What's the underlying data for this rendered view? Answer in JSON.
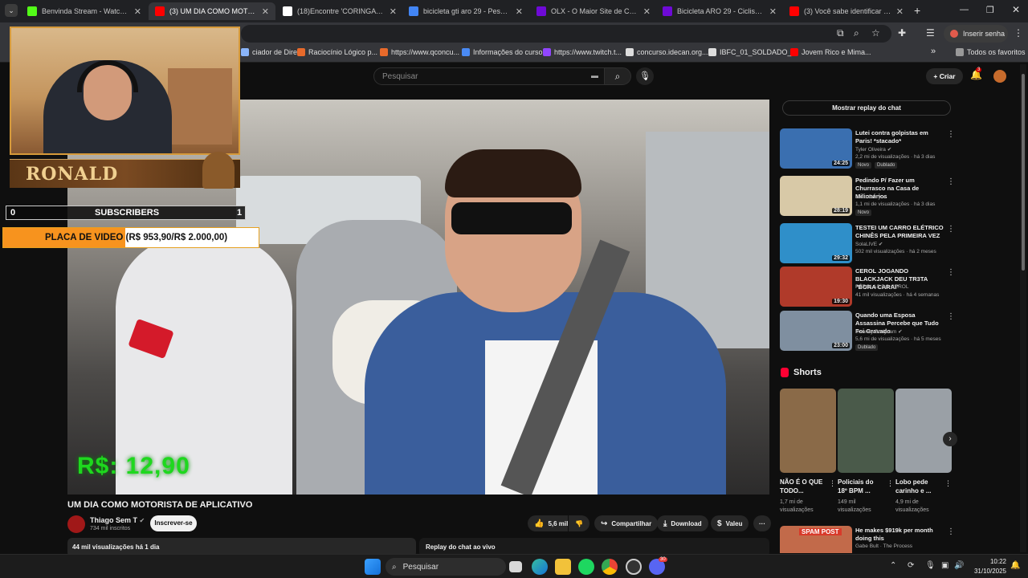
{
  "browser": {
    "tabs": [
      {
        "title": "Benvinda Stream - Watch Live o",
        "color": "#53fc18"
      },
      {
        "title": "(3) UM DIA COMO MOTOR",
        "color": "#ff0000",
        "active": true
      },
      {
        "title": "(18)Encontre 'CORINGA RESTA",
        "color": "#ffffff"
      },
      {
        "title": "bicicleta gti aro 29 - Pesquisa G",
        "color": "#4285f4"
      },
      {
        "title": "OLX - O Maior Site de Compra",
        "color": "#6e0ad6"
      },
      {
        "title": "Bicicleta ARO 29 - Ciclismo - S",
        "color": "#6e0ad6"
      },
      {
        "title": "(3) Você sabe identificar uma n",
        "color": "#ff0000"
      }
    ],
    "new_tab": "+",
    "incognito_label": "Inserir senha",
    "bookmarks": [
      {
        "label": "ciador de Dire...",
        "color": "#8ab4f8"
      },
      {
        "label": "Raciocínio Lógico p...",
        "color": "#e86a2b"
      },
      {
        "label": "https://www.qconcu...",
        "color": "#e86a2b"
      },
      {
        "label": "Informações do curso",
        "color": "#4a8af4"
      },
      {
        "label": "https://www.twitch.t...",
        "color": "#9146ff"
      },
      {
        "label": "concurso.idecan.org...",
        "color": "#dddddd"
      },
      {
        "label": "IBFC_01_SOLDADO_...",
        "color": "#dddddd"
      },
      {
        "label": "Jovem Rico e Mima...",
        "color": "#ff0000"
      }
    ],
    "bookmarks_overflow": "»",
    "all_bookmarks": "Todos os favoritos"
  },
  "youtube": {
    "search_placeholder": "Pesquisar",
    "create_label": "Criar",
    "notif_count": "3",
    "video": {
      "title": "UM DIA COMO MOTORISTA DE APLICATIVO",
      "price_overlay": "R$: 12,90",
      "channel_name": "Thiago Sem T",
      "channel_subs": "734 mil inscritos",
      "subscribe_label": "Inscrever-se",
      "likes": "5,6 mil",
      "share_label": "Compartilhar",
      "download_label": "Download",
      "thanks_label": "Valeu",
      "more_label": "···",
      "views_date": "44 mil visualizações  há 1 dia",
      "chat_replay_bottom": "Replay do chat ao vivo"
    },
    "chat_replay_button": "Mostrar replay do chat",
    "recommendations": [
      {
        "title": "Lutei contra golpistas em Paris! *stacado*",
        "channel": "Tyler Oliveira ✔",
        "meta": "2,2 mi de visualizações · há 3 dias",
        "duration": "24:25",
        "badge": "Novo",
        "badge2": "Dublado",
        "thumb": "#3a6fb0"
      },
      {
        "title": "Pedindo P/ Fazer um Churrasco na Casa de Milionários",
        "channel": "Joao Curry ✔",
        "meta": "1,1 mi de visualizações · há 3 dias",
        "duration": "28:19",
        "badge": "Novo",
        "badge2": "",
        "thumb": "#d8c9a7"
      },
      {
        "title": "TESTEI UM CARRO ELÉTRICO CHINÊS PELA PRIMEIRA VEZ",
        "channel": "SolaLIVE ✔",
        "meta": "502 mil visualizações · há 2 meses",
        "duration": "29:32",
        "badge": "",
        "badge2": "",
        "thumb": "#2f8fc9"
      },
      {
        "title": "CEROL JOGANDO BLACKJACK DEU TR3TA \"BORA CARAI\"",
        "channel": "PÉROLAS DO CEROL",
        "meta": "41 mil visualizações · há 4 semanas",
        "duration": "19:30",
        "badge": "",
        "badge2": "",
        "thumb": "#b03a2a"
      },
      {
        "title": "Quando uma Esposa Assassina Percebe que Tudo Foi Gravado",
        "channel": "Insanity Bodycam ✔",
        "meta": "5,6 mi de visualizações · há 5 meses",
        "duration": "23:00",
        "badge": "Dublado",
        "badge2": "",
        "thumb": "#7f8fa0"
      }
    ],
    "shorts_title": "Shorts",
    "shorts": [
      {
        "title": "NÃO É O QUE TODO...",
        "views": "1,7 mi de visualizações",
        "thumb": "#8a6a48"
      },
      {
        "title": "Policiais do 18º BPM ...",
        "views": "149 mil visualizações",
        "thumb": "#4a5a4a"
      },
      {
        "title": "Lobo pede carinho e ...",
        "views": "4,9 mi de visualizações",
        "thumb": "#9aa0a6"
      }
    ],
    "bottom_rec": {
      "title": "He makes $919k per month doing this",
      "channel": "Gabe Bult · The Process",
      "thumb": "#c26a4a",
      "badge": "SPAM POST"
    }
  },
  "stream_overlay": {
    "streamer_name": "RONALD",
    "subs_left": "0",
    "subs_label": "SUBSCRIBERS",
    "subs_right": "1",
    "goal_text": "PLACA DE VIDEO (R$ 953,90/R$ 2.000,00)",
    "goal_progress": 0.477
  },
  "taskbar": {
    "search_label": "Pesquisar",
    "time": "10:22",
    "date": "31/10/2025",
    "discord_badge": "30"
  }
}
